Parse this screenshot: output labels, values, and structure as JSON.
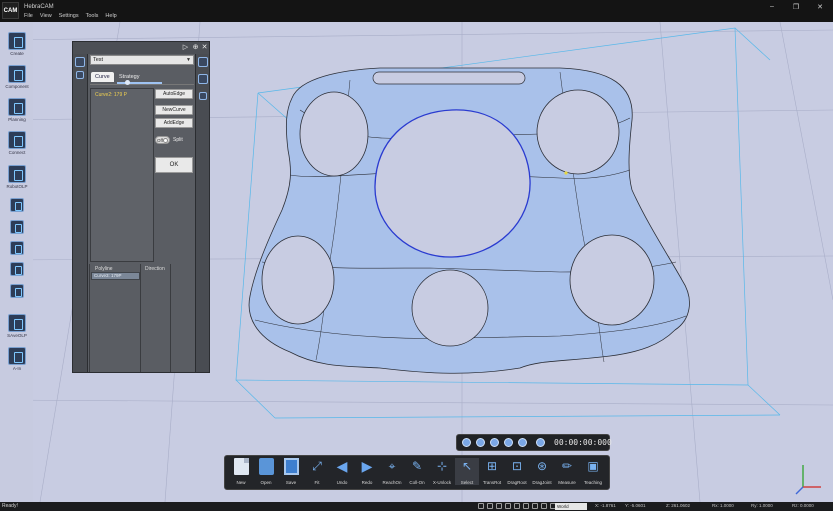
{
  "app": {
    "logo_text": "CAM",
    "title": "HebraCAM",
    "menu": [
      "File",
      "View",
      "Settings",
      "Tools",
      "Help"
    ],
    "window_controls": [
      "–",
      "❐",
      "✕"
    ]
  },
  "left_toolbar": [
    {
      "label": "Create",
      "icon": "create-icon"
    },
    {
      "label": "Component",
      "icon": "component-icon"
    },
    {
      "label": "Planning",
      "icon": "planning-icon"
    },
    {
      "label": "Connect",
      "icon": "connect-icon"
    },
    {
      "label": "RobotOLP",
      "icon": "robot-icon"
    },
    {
      "label": "",
      "icon": "tool-icon"
    },
    {
      "label": "",
      "icon": "gear-icon"
    },
    {
      "label": "",
      "icon": "dot-icon"
    },
    {
      "label": "",
      "icon": "layer-icon"
    },
    {
      "label": "",
      "icon": "clipboard-icon"
    },
    {
      "label": "SAveOLP",
      "icon": "save-olp-icon"
    },
    {
      "label": "A-In",
      "icon": "a-in-icon"
    }
  ],
  "panel": {
    "header_buttons": [
      "▷",
      "⊕",
      "✕"
    ],
    "select_value": "Test",
    "tabs": [
      {
        "label": "Curve",
        "active": true
      },
      {
        "label": "Strategy",
        "active": false
      }
    ],
    "curve_item": "Curve2: 179 P",
    "buttons": [
      "AutoEdge",
      "NewCurve",
      "AddEdge"
    ],
    "toggle_state": "Off",
    "toggle_label": "Split",
    "ok_label": "OK",
    "table_headers": [
      "Polyline",
      "Direction"
    ],
    "table_rows": [
      {
        "polyline": "Curve3: 179P"
      }
    ]
  },
  "playback": {
    "timecode": "00:00:00:000"
  },
  "bottom_toolbar": [
    {
      "label": "New",
      "icon": "new-icon"
    },
    {
      "label": "Open",
      "icon": "open-icon"
    },
    {
      "label": "Save",
      "icon": "save-icon"
    },
    {
      "label": "Fit",
      "icon": "fit-icon"
    },
    {
      "label": "Undo",
      "icon": "undo-icon"
    },
    {
      "label": "Redo",
      "icon": "redo-icon"
    },
    {
      "label": "ReachOn",
      "icon": "reach-on-icon"
    },
    {
      "label": "Coll-On",
      "icon": "collision-on-icon"
    },
    {
      "label": "X-Unlock",
      "icon": "unlock-icon"
    },
    {
      "label": "Select",
      "icon": "select-icon"
    },
    {
      "label": "TransRot",
      "icon": "transrot-icon"
    },
    {
      "label": "DragRoot",
      "icon": "dragroot-icon"
    },
    {
      "label": "DragJoint",
      "icon": "dragjoint-icon"
    },
    {
      "label": "Measure",
      "icon": "measure-icon"
    },
    {
      "label": "Teaching",
      "icon": "teaching-icon"
    }
  ],
  "status": {
    "ready": "Ready!",
    "frame": "World",
    "coords": [
      "X: -1.8761",
      "Y: -5.0601",
      "Z: 261.0602",
      "Rx: 1.0000",
      "Ry: 1.0000",
      "Rz: 0.0000"
    ]
  }
}
